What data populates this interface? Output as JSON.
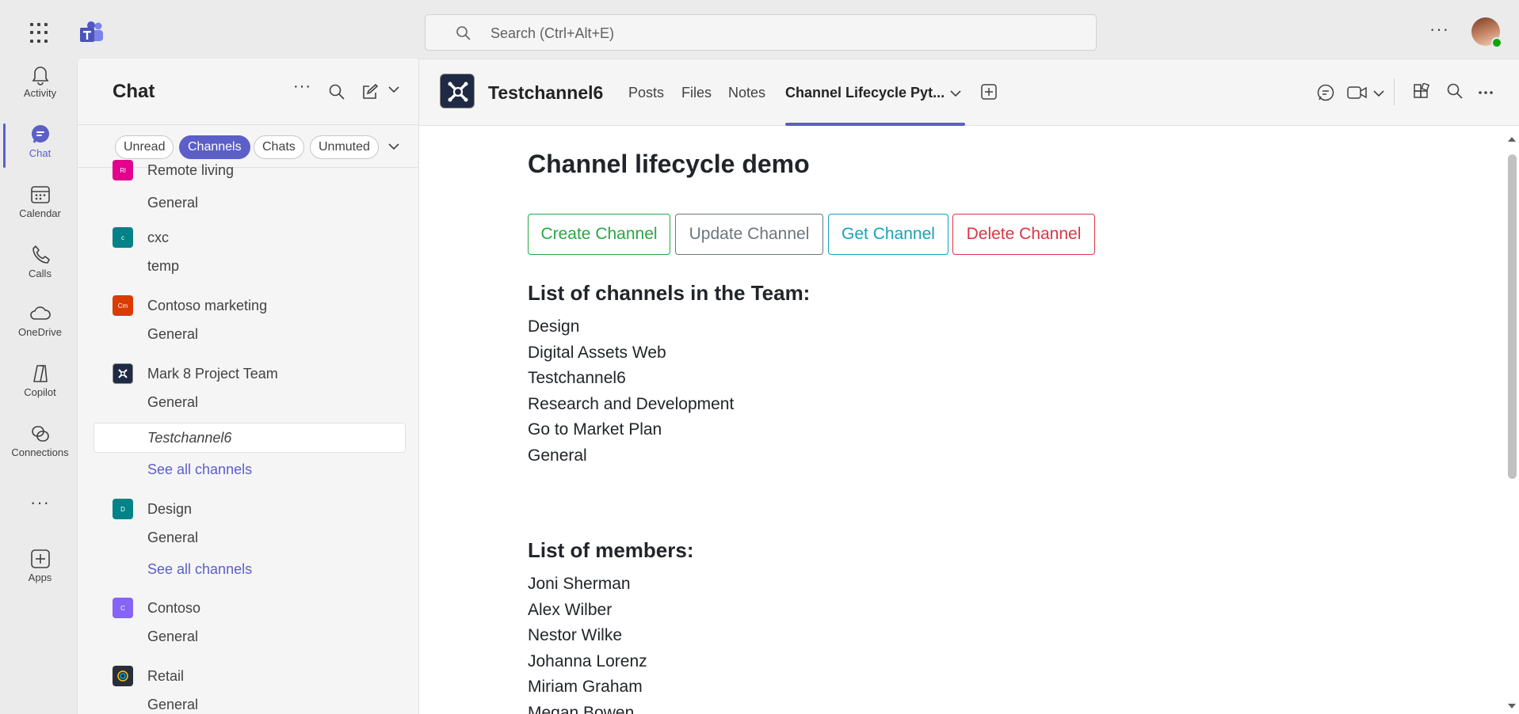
{
  "topbar": {
    "search_placeholder": "Search (Ctrl+Alt+E)",
    "more_glyph": "···"
  },
  "rail": {
    "items": [
      {
        "label": "Activity",
        "icon": "bell-icon"
      },
      {
        "label": "Chat",
        "icon": "chat-icon",
        "active": true
      },
      {
        "label": "Calendar",
        "icon": "calendar-icon"
      },
      {
        "label": "Calls",
        "icon": "phone-icon"
      },
      {
        "label": "OneDrive",
        "icon": "cloud-icon"
      },
      {
        "label": "Copilot",
        "icon": "copilot-icon"
      },
      {
        "label": "Connections",
        "icon": "connections-icon"
      },
      {
        "label": "Apps",
        "icon": "add-apps-icon"
      }
    ],
    "more_glyph": "···"
  },
  "chat": {
    "title": "Chat",
    "more_glyph": "···",
    "filters": [
      "Unread",
      "Channels",
      "Chats",
      "Unmuted"
    ],
    "selected_filter": "Channels",
    "list": {
      "team_remote": "Remote living",
      "remote_general": "General",
      "team_cxc": "cxc",
      "cxc_temp": "temp",
      "team_contoso_marketing": "Contoso marketing",
      "contoso_marketing_badge": "Cm",
      "contoso_marketing_general": "General",
      "team_mark8": "Mark 8 Project Team",
      "mark8_general": "General",
      "mark8_testchannel6": "Testchannel6",
      "mark8_see_all": "See all channels",
      "team_design": "Design",
      "design_badge": "D",
      "design_general": "General",
      "design_see_all": "See all channels",
      "team_contoso": "Contoso",
      "contoso_badge": "C",
      "contoso_general": "General",
      "team_retail": "Retail",
      "retail_general": "General",
      "cxc_badge": "c",
      "remote_badge": "Rl"
    }
  },
  "channel": {
    "name": "Testchannel6",
    "tabs": [
      "Posts",
      "Files",
      "Notes",
      "Channel Lifecycle Pyt..."
    ],
    "active_tab": "Channel Lifecycle Pyt..."
  },
  "app": {
    "title": "Channel lifecycle demo",
    "buttons": {
      "create": "Create Channel",
      "update": "Update Channel",
      "get": "Get Channel",
      "delete": "Delete Channel"
    },
    "channels_heading": "List of channels in the Team:",
    "channels": [
      "Design",
      "Digital Assets Web",
      "Testchannel6",
      "Research and Development",
      "Go to Market Plan",
      "General"
    ],
    "members_heading": "List of members:",
    "members": [
      "Joni Sherman",
      "Alex Wilber",
      "Nestor Wilke",
      "Johanna Lorenz",
      "Miriam Graham",
      "Megan Bowen"
    ]
  },
  "colors": {
    "accent": "#5b5fc7",
    "create": "#28a745",
    "update": "#6c757d",
    "get": "#17a2b8",
    "delete": "#dc3545",
    "pink_team": "#e3008c",
    "teal_team": "#038387",
    "orange_team": "#da3b01",
    "purple_team": "#8764f5"
  }
}
